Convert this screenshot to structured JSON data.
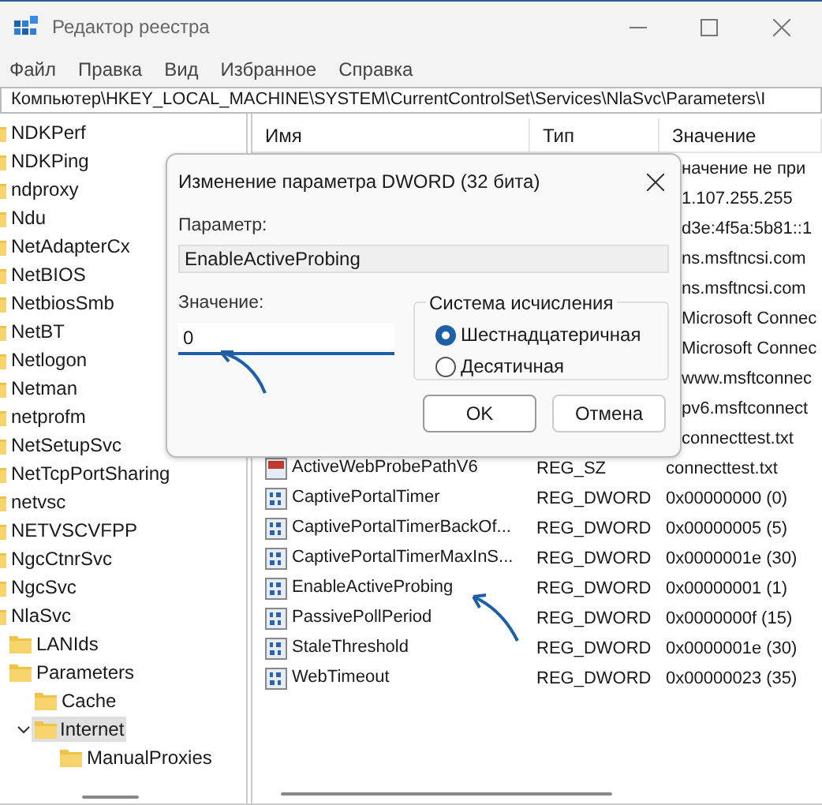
{
  "window": {
    "title": "Редактор реестра"
  },
  "menu": [
    "Файл",
    "Правка",
    "Вид",
    "Избранное",
    "Справка"
  ],
  "address": "Компьютер\\HKEY_LOCAL_MACHINE\\SYSTEM\\CurrentControlSet\\Services\\NlaSvc\\Parameters\\I",
  "tree": [
    {
      "label": "NDKPerf",
      "selected": false
    },
    {
      "label": "NDKPing",
      "selected": false
    },
    {
      "label": "ndproxy",
      "selected": false
    },
    {
      "label": "Ndu",
      "selected": false
    },
    {
      "label": "NetAdapterCx",
      "selected": false
    },
    {
      "label": "NetBIOS",
      "selected": false
    },
    {
      "label": "NetbiosSmb",
      "selected": false
    },
    {
      "label": "NetBT",
      "selected": false
    },
    {
      "label": "Netlogon",
      "selected": false
    },
    {
      "label": "Netman",
      "selected": false
    },
    {
      "label": "netprofm",
      "selected": false
    },
    {
      "label": "NetSetupSvc",
      "selected": false
    },
    {
      "label": "NetTcpPortSharing",
      "selected": false
    },
    {
      "label": "netvsc",
      "selected": false
    },
    {
      "label": "NETVSCVFPP",
      "selected": false
    },
    {
      "label": "NgcCtnrSvc",
      "selected": false
    },
    {
      "label": "NgcSvc",
      "selected": false
    },
    {
      "label": "NlaSvc",
      "selected": false,
      "children": [
        {
          "label": "LANIds",
          "selected": false
        },
        {
          "label": "Parameters",
          "selected": false,
          "children": [
            {
              "label": "Cache",
              "selected": false
            },
            {
              "label": "Internet",
              "selected": true,
              "expanded": true,
              "children": [
                {
                  "label": "ManualProxies",
                  "selected": false
                }
              ]
            }
          ]
        }
      ]
    }
  ],
  "table": {
    "columns": [
      "Имя",
      "Тип",
      "Значение"
    ],
    "rows": [
      {
        "value": "начение не при"
      },
      {
        "value": "1.107.255.255"
      },
      {
        "value": "d3e:4f5a:5b81::1"
      },
      {
        "value": "ns.msftncsi.com"
      },
      {
        "value": "ns.msftncsi.com"
      },
      {
        "value": "Microsoft Connec"
      },
      {
        "value": "Microsoft Connec"
      },
      {
        "value": "www.msftconnec"
      },
      {
        "value": "pv6.msftconnect"
      },
      {
        "value": "connecttest.txt"
      },
      {
        "kind": "string",
        "name": "ActiveWebProbePathV6",
        "type": "REG_SZ",
        "value": "connecttest.txt"
      },
      {
        "kind": "dword",
        "name": "CaptivePortalTimer",
        "type": "REG_DWORD",
        "value": "0x00000000 (0)"
      },
      {
        "kind": "dword",
        "name": "CaptivePortalTimerBackOf...",
        "type": "REG_DWORD",
        "value": "0x00000005 (5)"
      },
      {
        "kind": "dword",
        "name": "CaptivePortalTimerMaxInS...",
        "type": "REG_DWORD",
        "value": "0x0000001e (30)"
      },
      {
        "kind": "dword",
        "name": "EnableActiveProbing",
        "type": "REG_DWORD",
        "value": "0x00000001 (1)"
      },
      {
        "kind": "dword",
        "name": "PassivePollPeriod",
        "type": "REG_DWORD",
        "value": "0x0000000f (15)"
      },
      {
        "kind": "dword",
        "name": "StaleThreshold",
        "type": "REG_DWORD",
        "value": "0x0000001e (30)"
      },
      {
        "kind": "dword",
        "name": "WebTimeout",
        "type": "REG_DWORD",
        "value": "0x00000023 (35)"
      }
    ]
  },
  "dialog": {
    "title": "Изменение параметра DWORD (32 бита)",
    "param_label": "Параметр:",
    "param_value": "EnableActiveProbing",
    "value_label": "Значение:",
    "value": "0",
    "base_title": "Система исчисления",
    "bases": [
      {
        "label": "Шестнадцатеричная",
        "selected": true
      },
      {
        "label": "Десятичная",
        "selected": false
      }
    ],
    "buttons": [
      "OK",
      "Отмена"
    ]
  }
}
